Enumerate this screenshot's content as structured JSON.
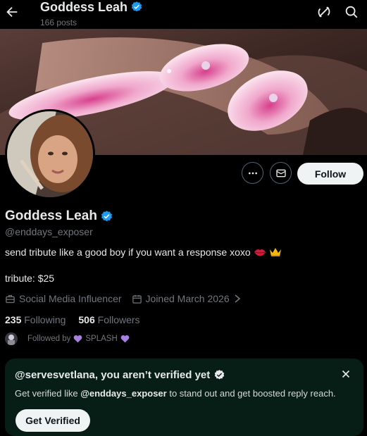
{
  "header": {
    "title": "Goddess Leah",
    "post_count": "166 posts"
  },
  "profile": {
    "name": "Goddess Leah",
    "handle": "@enddays_exposer",
    "bio_text": "send tribute like a good boy if you want a response xoxo",
    "bio_emoji": [
      "lips-emoji",
      "crown-emoji"
    ],
    "tribute": "tribute: $25",
    "category": "Social Media Influencer",
    "joined": "Joined March 2026",
    "following_count": "235",
    "following_label": "Following",
    "followers_count": "506",
    "followers_label": "Followers",
    "followed_by_prefix": "Followed by",
    "followed_by_name": "SPLASH",
    "follow_button": "Follow"
  },
  "verify_card": {
    "title": "@servesvetlana, you aren’t verified yet",
    "text_prefix": "Get verified like ",
    "text_handle": "@enddays_exposer",
    "text_suffix": " to stand out and get boosted reply reach.",
    "button": "Get Verified"
  },
  "colors": {
    "background": "#000000",
    "verified_blue": "#1d9bf0",
    "muted_text": "#71767b",
    "card_bg": "#071e17",
    "heart_purple": "#a67fe0"
  }
}
